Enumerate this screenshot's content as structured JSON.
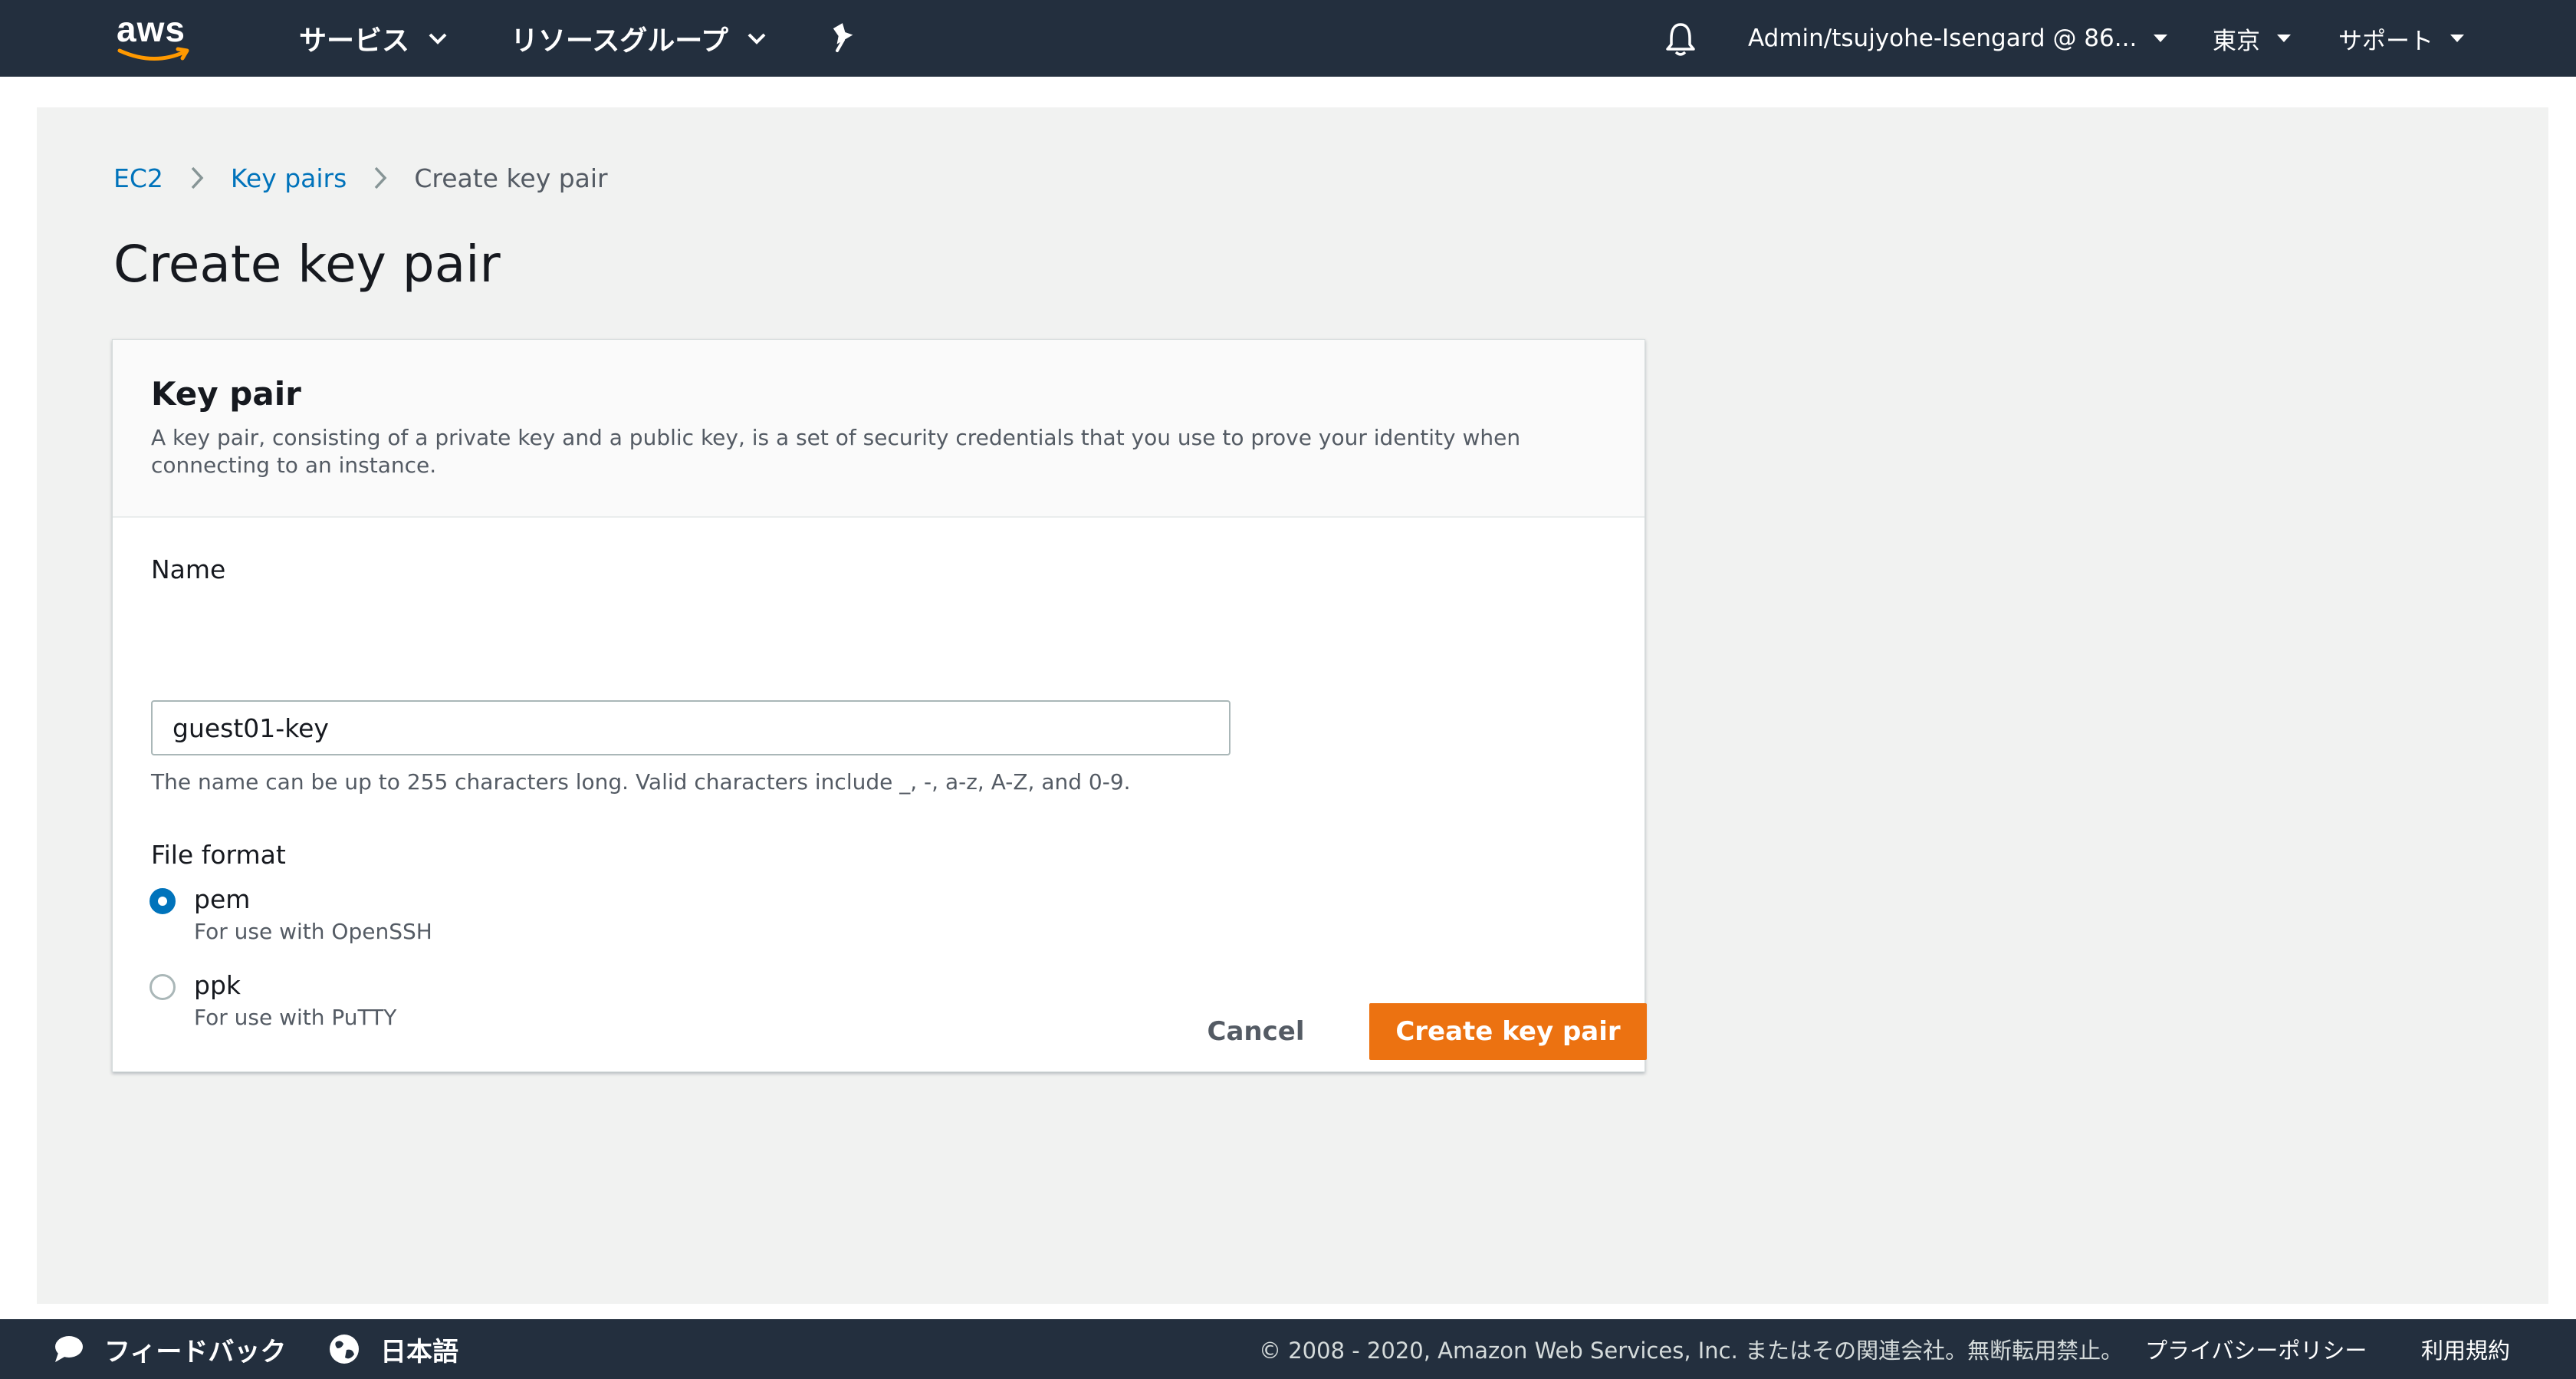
{
  "topnav": {
    "logo_text": "aws",
    "services_label": "サービス",
    "resource_groups_label": "リソースグループ",
    "account_label": "Admin/tsujyohe-Isengard @ 86...",
    "region_label": "東京",
    "support_label": "サポート",
    "icons": [
      "pin-icon",
      "bell-icon"
    ]
  },
  "breadcrumb": {
    "items": [
      "EC2",
      "Key pairs"
    ],
    "current": "Create key pair"
  },
  "page_title": "Create key pair",
  "panel": {
    "title": "Key pair",
    "description": "A key pair, consisting of a private key and a public key, is a set of security credentials that you use to prove your identity when connecting to an instance.",
    "name_label": "Name",
    "name_value": "guest01-key",
    "name_hint": "The name can be up to 255 characters long. Valid characters include _, -, a-z, A-Z, and 0-9.",
    "file_format_label": "File format",
    "formats": [
      {
        "label": "pem",
        "description": "For use with OpenSSH",
        "selected": true
      },
      {
        "label": "ppk",
        "description": "For use with PuTTY",
        "selected": false
      }
    ]
  },
  "actions": {
    "cancel_label": "Cancel",
    "create_label": "Create key pair"
  },
  "footer": {
    "feedback_label": "フィードバック",
    "language_label": "日本語",
    "copyright": "© 2008 - 2020, Amazon Web Services, Inc. またはその関連会社。無断転用禁止。",
    "privacy_label": "プライバシーポリシー",
    "terms_label": "利用規約"
  },
  "colors": {
    "nav_bg": "#232f3e",
    "link": "#0073bb",
    "primary_button": "#ec7211",
    "logo_smile": "#ff9900"
  }
}
